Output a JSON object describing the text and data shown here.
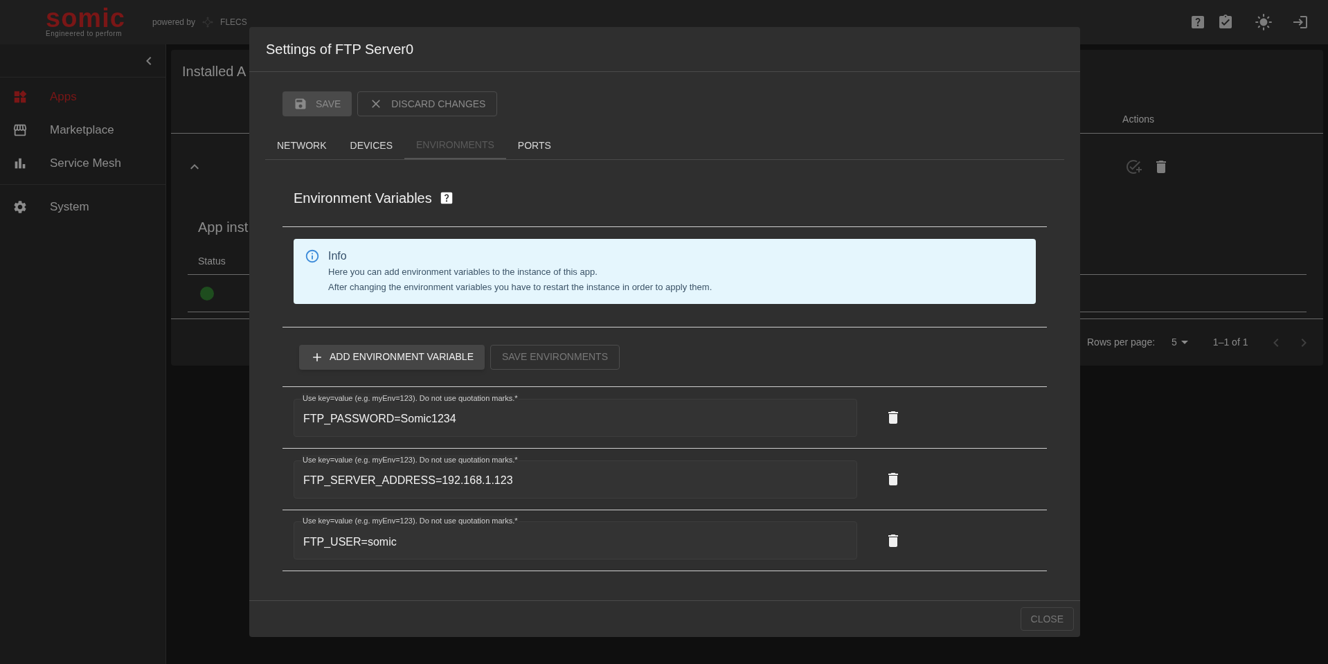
{
  "header": {
    "wordmark": "somic",
    "tagline": "Engineered to perform",
    "powered_by": "powered by",
    "brand": "FLECS"
  },
  "sidebar": {
    "groups": [
      {
        "items": [
          {
            "label": "Apps",
            "selected": true
          },
          {
            "label": "Marketplace",
            "selected": false
          },
          {
            "label": "Service Mesh",
            "selected": false
          }
        ]
      },
      {
        "items": [
          {
            "label": "System",
            "selected": false
          }
        ]
      }
    ]
  },
  "page": {
    "title": "Installed A",
    "column": "Actions",
    "row": {
      "expanded": true
    },
    "instances": {
      "title": "App inst",
      "column": "Status",
      "rows": [
        {
          "color": "#1e4d1e"
        }
      ]
    },
    "pagination": {
      "label": "Rows per page:",
      "rows_per_page": "5",
      "range": "1–1 of 1"
    }
  },
  "dialog": {
    "title": "Settings of FTP Server0",
    "toolbar": [
      {
        "kind": "save",
        "label": "SAVE",
        "disabled": true
      },
      {
        "kind": "discard",
        "label": "DISCARD CHANGES",
        "disabled": true
      }
    ],
    "tabs": [
      {
        "label": "NETWORK",
        "selected": false
      },
      {
        "label": "DEVICES",
        "selected": false
      },
      {
        "label": "ENVIRONMENTS",
        "selected": true
      },
      {
        "label": "PORTS",
        "selected": false
      }
    ],
    "section_title": "Environment Variables",
    "info": {
      "title": "Info",
      "lines": [
        "Here you can add environment variables to the instance of this app.",
        "After changing the environment variables you have to restart the instance in order to apply them."
      ]
    },
    "actions": [
      {
        "kind": "add",
        "label": "ADD ENVIRONMENT VARIABLE",
        "disabled": false
      },
      {
        "kind": "save",
        "label": "SAVE ENVIRONMENTS",
        "disabled": true
      }
    ],
    "variables": [
      {
        "label": "Use key=value (e.g. myEnv=123). Do not use quotation marks.*",
        "value": "FTP_PASSWORD=Somic1234"
      },
      {
        "label": "Use key=value (e.g. myEnv=123). Do not use quotation marks.*",
        "value": "FTP_SERVER_ADDRESS=192.168.1.123"
      },
      {
        "label": "Use key=value (e.g. myEnv=123). Do not use quotation marks.*",
        "value": "FTP_USER=somic"
      }
    ],
    "close": {
      "label": "CLOSE",
      "disabled": true
    }
  }
}
